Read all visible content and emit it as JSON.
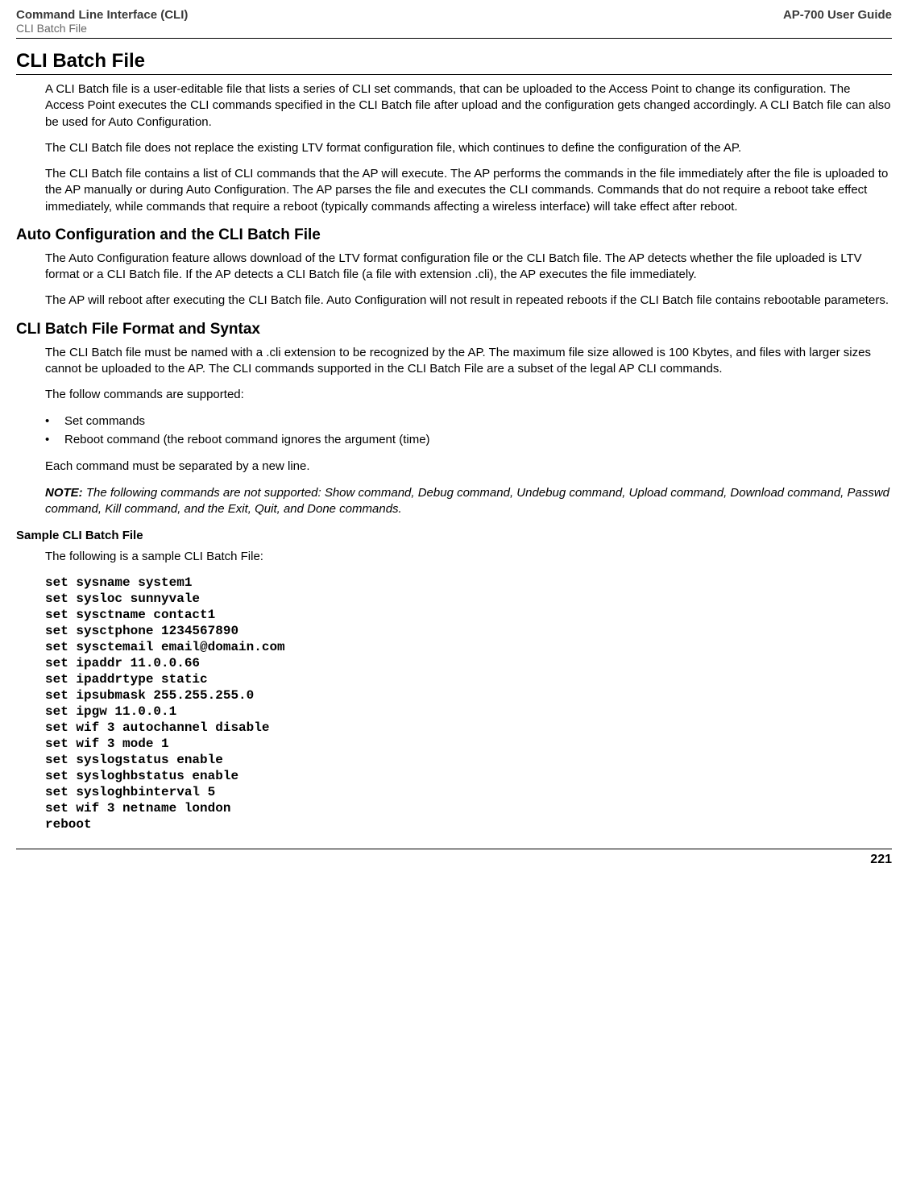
{
  "header": {
    "left_line1": "Command Line Interface (CLI)",
    "left_line2": "CLI Batch File",
    "right": "AP-700 User Guide"
  },
  "title": "CLI Batch File",
  "para1": "A CLI Batch file is a user-editable file that lists a series of CLI set commands, that can be uploaded to the Access Point to change its configuration. The Access Point executes the CLI commands specified in the CLI Batch file after upload and the configuration gets changed accordingly. A CLI Batch file can also be used for Auto Configuration.",
  "para2": "The CLI Batch file does not replace the existing LTV format configuration file, which continues to define the configuration of the AP.",
  "para3": "The CLI Batch file contains a list of CLI commands that the AP will execute. The AP performs the commands in the file immediately after the file is uploaded to the AP manually or during Auto Configuration. The AP parses the file and executes the CLI commands. Commands that do not require a reboot take effect immediately, while commands that require a reboot (typically commands affecting a wireless interface) will take effect after reboot.",
  "sub1": {
    "heading": "Auto Configuration and the CLI Batch File",
    "p1": "The Auto Configuration feature allows download of the LTV format configuration file or the CLI Batch file. The AP detects whether the file uploaded is LTV format or a CLI Batch file. If the AP detects a CLI Batch file (a file with extension .cli), the AP executes the file immediately.",
    "p2": "The AP will reboot after executing the CLI Batch file. Auto Configuration will not result in repeated reboots if the CLI Batch file contains rebootable parameters."
  },
  "sub2": {
    "heading": "CLI Batch File Format and Syntax",
    "p1": "The CLI Batch file must be named with a .cli extension to be recognized by the AP. The maximum file size allowed is 100 Kbytes, and files with larger sizes cannot be uploaded to the AP. The CLI commands supported in the CLI Batch File are a subset of the legal AP CLI commands.",
    "p2": "The follow commands are supported:",
    "bullets": [
      "Set commands",
      "Reboot command (the reboot command ignores the argument (time)"
    ],
    "p3": "Each command must be separated by a new line.",
    "note_label": "NOTE:",
    "note_body": "The following commands are not supported: Show command, Debug command, Undebug command, Upload command, Download command, Passwd command, Kill command, and the Exit, Quit, and Done commands."
  },
  "sample": {
    "heading": "Sample CLI Batch File",
    "intro": "The following is a sample CLI Batch File:",
    "code": "set sysname system1\nset sysloc sunnyvale\nset sysctname contact1\nset sysctphone 1234567890\nset sysctemail email@domain.com\nset ipaddr 11.0.0.66\nset ipaddrtype static\nset ipsubmask 255.255.255.0\nset ipgw 11.0.0.1\nset wif 3 autochannel disable\nset wif 3 mode 1\nset syslogstatus enable\nset sysloghbstatus enable\nset sysloghbinterval 5\nset wif 3 netname london\nreboot"
  },
  "page_number": "221"
}
